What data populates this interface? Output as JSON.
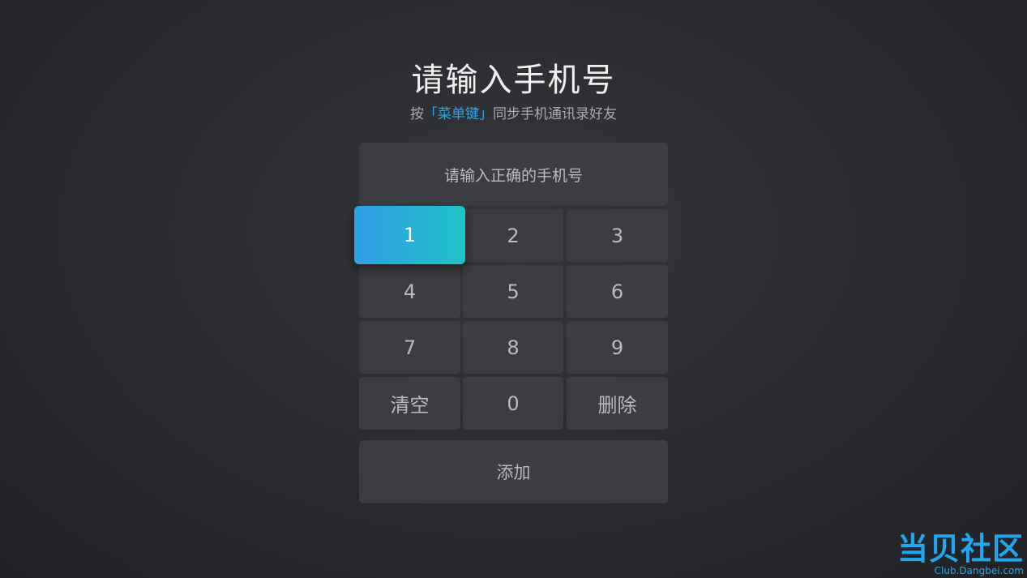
{
  "header": {
    "title": "请输入手机号",
    "subtitle_prefix": "按",
    "subtitle_highlight": "「菜单键」",
    "subtitle_suffix": "同步手机通讯录好友"
  },
  "input": {
    "placeholder": "请输入正确的手机号"
  },
  "keypad": {
    "focused_key": "1",
    "keys": [
      "1",
      "2",
      "3",
      "4",
      "5",
      "6",
      "7",
      "8",
      "9",
      "清空",
      "0",
      "删除"
    ]
  },
  "actions": {
    "add_label": "添加"
  },
  "watermark": {
    "brand": "当贝社区",
    "url": "Club.Dangbei.com"
  },
  "colors": {
    "accent_start": "#2f9ee6",
    "accent_end": "#1fc3c7",
    "highlight_text": "#2ea6e8",
    "watermark": "#1fa7f0"
  }
}
